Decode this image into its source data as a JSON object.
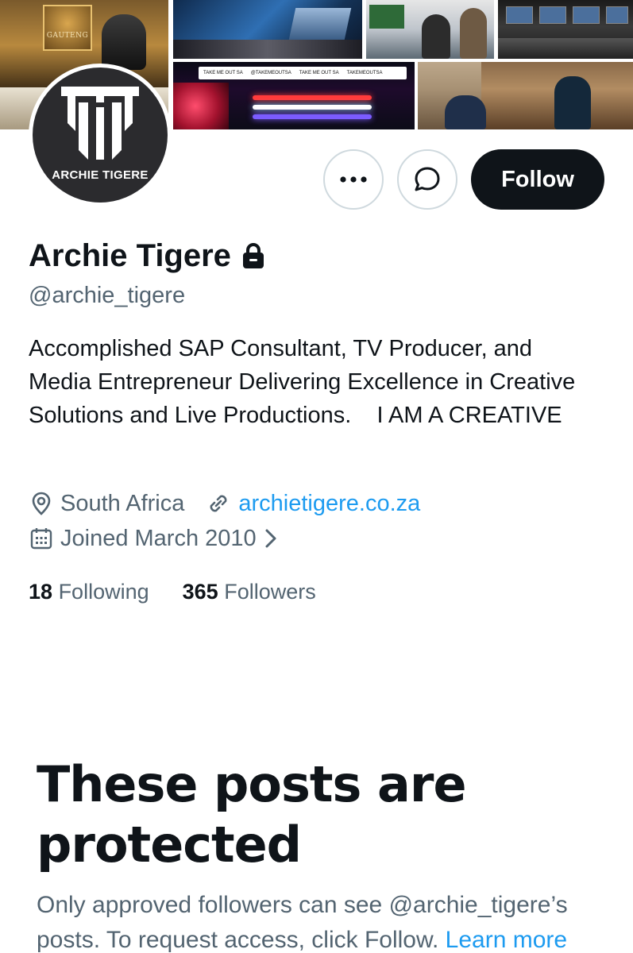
{
  "banner": {
    "studio_sign": "GAUTENG",
    "strip_items": [
      "TAKE ME OUT SA",
      "@TAKEMEOUTSA",
      "TAKE ME OUT SA",
      "TAKEMEOUTSA"
    ]
  },
  "avatar": {
    "logo_text": "ARCHIE TIGERE"
  },
  "actions": {
    "more_icon": "more-horizontal-icon",
    "message_icon": "message-bubble-icon",
    "follow_label": "Follow"
  },
  "profile": {
    "name": "Archie Tigere",
    "lock_icon": "lock-icon",
    "handle": "@archie_tigere",
    "bio": "Accomplished SAP Consultant, TV Producer, and Media Entrepreneur Delivering Excellence in Creative Solutions and Live Productions.    I AM A CREATIVE",
    "location": "South Africa",
    "website": "archietigere.co.za",
    "joined": "Joined March 2010",
    "following_count": "18",
    "following_label": "Following",
    "followers_count": "365",
    "followers_label": "Followers"
  },
  "protected": {
    "title": "These posts are protected",
    "description": "Only approved followers can see @archie_tigere’s posts. To request access, click Follow.",
    "learn_more": "Learn more"
  },
  "colors": {
    "text_primary": "#0f1419",
    "text_secondary": "#536471",
    "link": "#1d9bf0",
    "button_dark": "#0f1419",
    "border": "#cfd9de"
  }
}
